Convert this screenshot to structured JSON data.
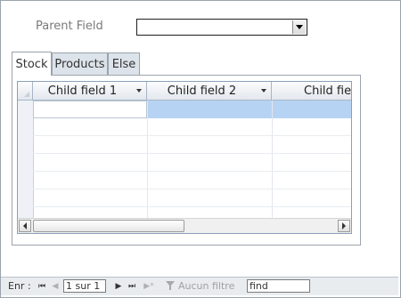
{
  "form": {
    "parent_field_label": "Parent Field",
    "parent_field_value": ""
  },
  "tabs": [
    {
      "label": "Stock",
      "active": true
    },
    {
      "label": "Products",
      "active": false
    },
    {
      "label": "Else",
      "active": false
    }
  ],
  "subform": {
    "columns": [
      "Child field 1",
      "Child field 2",
      "Child fie"
    ],
    "row_count_visible": 7,
    "selected_cell_color": "#b7d3f3"
  },
  "navbar": {
    "record_label": "Enr :",
    "first_icon": "⏮",
    "prev_icon": "◀",
    "position": "1 sur 1",
    "next_icon": "▶",
    "last_icon": "⏭",
    "new_icon": "▶*",
    "filter_label": "Aucun filtre",
    "search_value": "find"
  }
}
